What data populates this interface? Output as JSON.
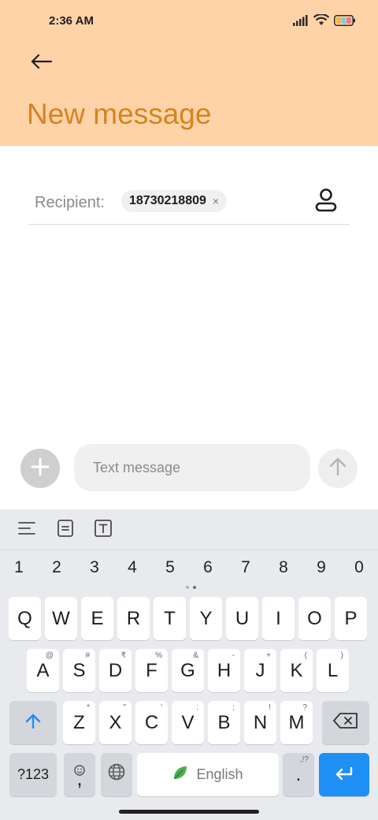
{
  "status_bar": {
    "time": "2:36 AM",
    "icons": [
      "signal-icon",
      "wifi-icon",
      "battery-icon"
    ]
  },
  "header": {
    "back_icon": "back-arrow-icon",
    "title": "New message",
    "background_color": "#FFD3A8",
    "title_color": "#D8831F"
  },
  "recipient": {
    "label": "Recipient:",
    "chip_value": "18730218809",
    "chip_close": "×",
    "contact_icon": "contact-person-icon"
  },
  "compose": {
    "add_icon": "plus-icon",
    "placeholder": "Text message",
    "value": "",
    "send_icon": "send-arrow-icon"
  },
  "keyboard": {
    "toolbar_icons": [
      "text-align-icon",
      "clipboard-icon",
      "text-format-icon"
    ],
    "numbers": [
      "1",
      "2",
      "3",
      "4",
      "5",
      "6",
      "7",
      "8",
      "9",
      "0"
    ],
    "row1": [
      {
        "key": "Q"
      },
      {
        "key": "W"
      },
      {
        "key": "E"
      },
      {
        "key": "R"
      },
      {
        "key": "T"
      },
      {
        "key": "Y"
      },
      {
        "key": "U"
      },
      {
        "key": "I"
      },
      {
        "key": "O"
      },
      {
        "key": "P"
      }
    ],
    "row2": [
      {
        "key": "A",
        "sub": "@"
      },
      {
        "key": "S",
        "sub": "#"
      },
      {
        "key": "D",
        "sub": "₹"
      },
      {
        "key": "F",
        "sub": "%"
      },
      {
        "key": "G",
        "sub": "&"
      },
      {
        "key": "H",
        "sub": "-"
      },
      {
        "key": "J",
        "sub": "+"
      },
      {
        "key": "K",
        "sub": "("
      },
      {
        "key": "L",
        "sub": ")"
      }
    ],
    "row3": [
      {
        "key": "Z",
        "sub": "*"
      },
      {
        "key": "X",
        "sub": "\""
      },
      {
        "key": "C",
        "sub": "'"
      },
      {
        "key": "V",
        "sub": ":"
      },
      {
        "key": "B",
        "sub": ";"
      },
      {
        "key": "N",
        "sub": "!"
      },
      {
        "key": "M",
        "sub": "?"
      }
    ],
    "shift_icon": "shift-arrow-icon",
    "backspace_icon": "backspace-icon",
    "symbols_label": "?123",
    "comma_label": ",",
    "emoji_icon": "emoji-icon",
    "globe_icon": "globe-icon",
    "space_label": "English",
    "space_icon": "leaf-icon",
    "period_label": ".",
    "period_sub": ",!?",
    "enter_icon": "enter-icon",
    "accent_color": "#1E8FF5"
  }
}
